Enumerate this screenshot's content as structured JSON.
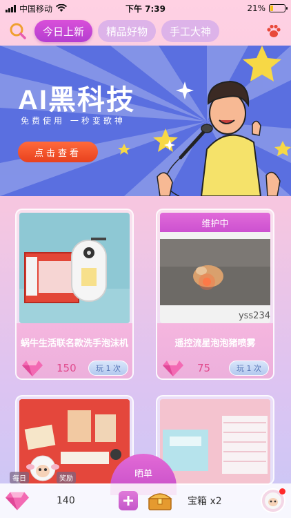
{
  "status_bar": {
    "carrier": "中国移动",
    "time": "下午 7:39",
    "battery": "21%",
    "battery_level": 0.21
  },
  "nav": {
    "search_icon": "search-icon",
    "tabs": [
      {
        "label": "今日上新",
        "active": true
      },
      {
        "label": "精品好物",
        "active": false
      },
      {
        "label": "手工大神",
        "active": false
      }
    ],
    "paw_icon": "paw-icon"
  },
  "banner": {
    "title": "AI黑科技",
    "subtitle": "免费使用  一秒变歌神",
    "button": "点击查看"
  },
  "cards": [
    {
      "name": "蜗牛生活联名款洗手泡沫机",
      "price": "150",
      "play_label": "玩 1 次",
      "maintenance": ""
    },
    {
      "name": "遥控流星泡泡猪喷雾",
      "price": "75",
      "play_label": "玩 1 次",
      "maintenance": "维护中",
      "watermark": "yss234"
    }
  ],
  "bottom": {
    "daily_tag": "每日",
    "reward_tag": "奖励",
    "show_button": "晒单",
    "gem_count": "140",
    "plus_icon": "plus-icon",
    "chest_label": "宝箱 x2"
  },
  "colors": {
    "accent": "#c94fd0",
    "banner_bg": "#5a6fe0",
    "price": "#e04a8c"
  }
}
